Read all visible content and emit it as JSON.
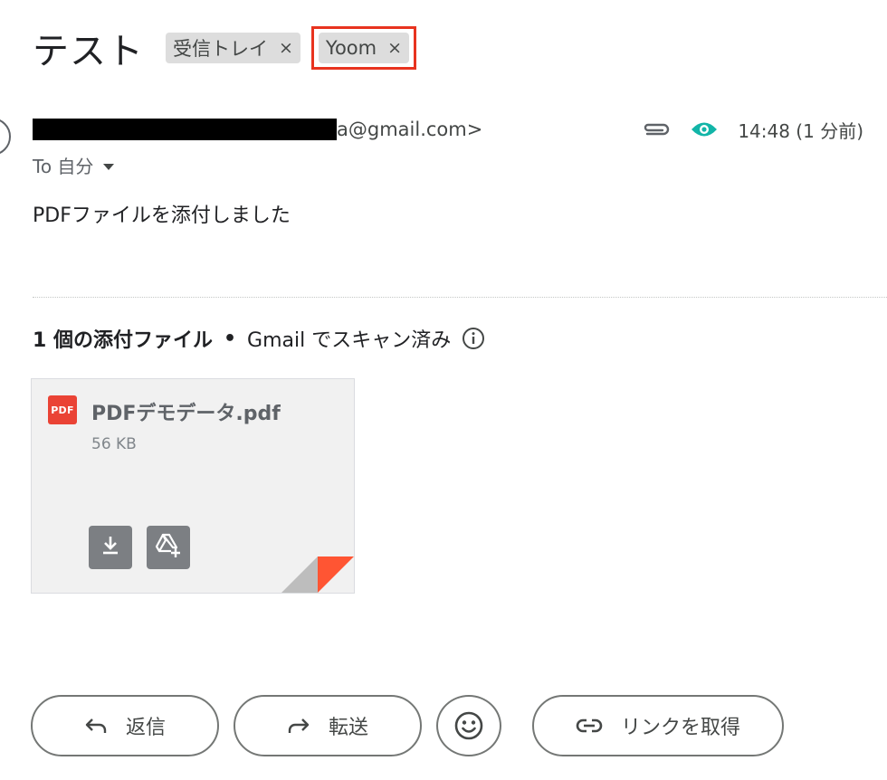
{
  "email": {
    "subject": "テスト",
    "labels": [
      {
        "name": "受信トレイ",
        "remove": "×"
      },
      {
        "name": "Yoom",
        "remove": "×"
      }
    ],
    "sender_visible_suffix": "a@gmail.com>",
    "time": "14:48 (1 分前)",
    "to_line": "To 自分",
    "body": "PDFファイルを添付しました"
  },
  "attachments": {
    "count_label": "1 個の添付ファイル",
    "separator": "•",
    "scan_label": "Gmail でスキャン済み",
    "files": [
      {
        "name": "PDFデモデータ.pdf",
        "size": "56 KB",
        "badge": "PDF"
      }
    ]
  },
  "actions": {
    "reply": "返信",
    "forward": "転送",
    "get_link": "リンクを取得"
  },
  "colors": {
    "highlight": "#e8331f",
    "tracker_eye": "#12b5a8",
    "pdf_red": "#ea4335",
    "card_bg": "#f1f1f1"
  },
  "icons": {
    "attachment": "paperclip-icon",
    "tracker": "eye-icon",
    "to_dropdown": "caret-down-icon",
    "info": "info-icon",
    "download": "download-icon",
    "drive": "drive-add-icon",
    "reply": "reply-arrow-icon",
    "forward": "forward-arrow-icon",
    "emoji": "smiley-icon",
    "link": "link-icon"
  }
}
